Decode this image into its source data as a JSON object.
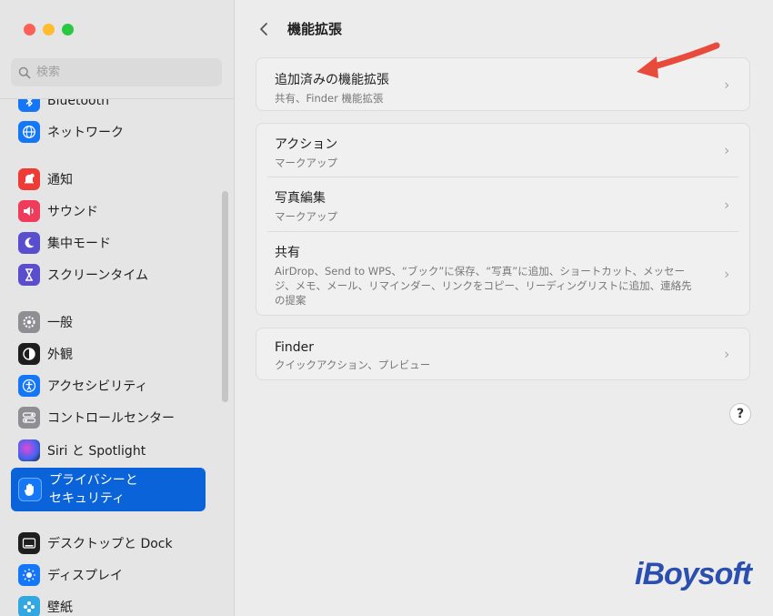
{
  "search": {
    "placeholder": "検索"
  },
  "sidebar": {
    "items": [
      {
        "label": "Bluetooth",
        "icon": "bluetooth-icon",
        "color": "#1477f7"
      },
      {
        "label": "ネットワーク",
        "icon": "globe-icon",
        "color": "#1477f7"
      },
      {
        "label": "通知",
        "icon": "bell-icon",
        "color": "#ef3b35"
      },
      {
        "label": "サウンド",
        "icon": "speaker-icon",
        "color": "#ef3b5c"
      },
      {
        "label": "集中モード",
        "icon": "moon-icon",
        "color": "#5a4ecf"
      },
      {
        "label": "スクリーンタイム",
        "icon": "hourglass-icon",
        "color": "#5a4ecf"
      },
      {
        "label": "一般",
        "icon": "gear-icon",
        "color": "#8e8e93"
      },
      {
        "label": "外観",
        "icon": "appearance-icon",
        "color": "#1e1e1e"
      },
      {
        "label": "アクセシビリティ",
        "icon": "accessibility-icon",
        "color": "#1477f7"
      },
      {
        "label": "コントロールセンター",
        "icon": "control-center-icon",
        "color": "#8e8e93"
      },
      {
        "label": "Siri と Spotlight",
        "icon": "siri-icon",
        "color": "#6b3fc6"
      },
      {
        "label": "プライバシーと\nセキュリティ",
        "icon": "hand-icon",
        "color": "#1477f7"
      },
      {
        "label": "デスクトップと Dock",
        "icon": "dock-icon",
        "color": "#1e1e1e"
      },
      {
        "label": "ディスプレイ",
        "icon": "sun-icon",
        "color": "#1477f7"
      },
      {
        "label": "壁紙",
        "icon": "wallpaper-icon",
        "color": "#32a8e0"
      }
    ]
  },
  "main": {
    "title": "機能拡張",
    "groups": [
      {
        "rows": [
          {
            "title": "追加済みの機能拡張",
            "subtitle": "共有、Finder 機能拡張"
          }
        ]
      },
      {
        "rows": [
          {
            "title": "アクション",
            "subtitle": "マークアップ"
          },
          {
            "title": "写真編集",
            "subtitle": "マークアップ"
          },
          {
            "title": "共有",
            "subtitle": "AirDrop、Send to WPS、“ブック”に保存、“写真”に追加、ショートカット、メッセージ、メモ、メール、リマインダー、リンクをコピー、リーディングリストに追加、連絡先の提案"
          }
        ]
      },
      {
        "rows": [
          {
            "title": "Finder",
            "subtitle": "クイックアクション、プレビュー"
          }
        ]
      }
    ],
    "help_label": "?"
  },
  "watermark": "iBoysoft",
  "colors": {
    "selected": "#0a63d8",
    "arrow": "#e84b3c"
  }
}
